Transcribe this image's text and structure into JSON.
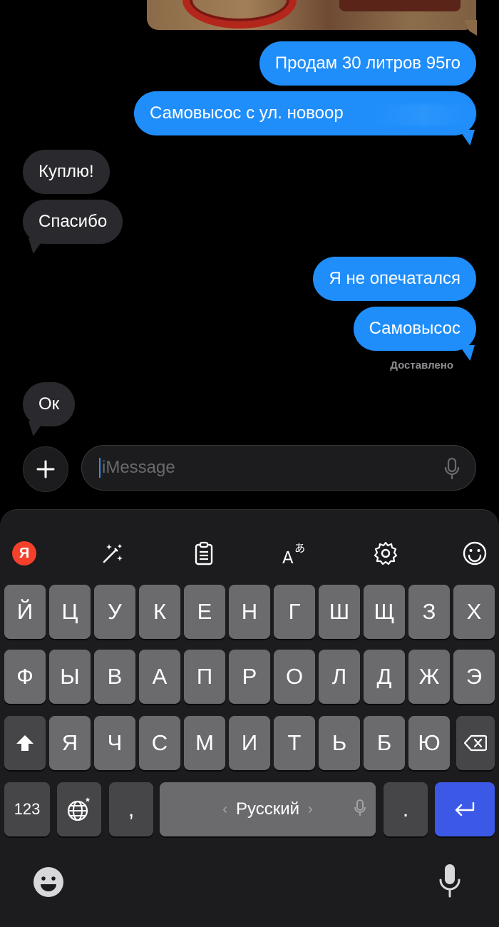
{
  "chat": {
    "messages": [
      {
        "direction": "out",
        "text": "Продам 30 литров 95го"
      },
      {
        "direction": "out",
        "text": "Самовысос с ул. новоор"
      },
      {
        "direction": "in",
        "text": "Куплю!"
      },
      {
        "direction": "in",
        "text": "Спасибо"
      },
      {
        "direction": "out",
        "text": "Я не опечатался"
      },
      {
        "direction": "out",
        "text": "Самовысос"
      },
      {
        "direction": "in",
        "text": "Ок"
      }
    ],
    "delivered_label": "Доставлено"
  },
  "input_bar": {
    "placeholder": "iMessage",
    "plus_icon": "plus-icon",
    "mic_icon": "microphone-icon"
  },
  "keyboard": {
    "toolbar_icons": [
      "yandex-logo-icon",
      "magic-wand-icon",
      "clipboard-icon",
      "translate-icon",
      "gear-icon",
      "smiley-icon"
    ],
    "yandex_logo_letter": "Я",
    "row1": [
      "Й",
      "Ц",
      "У",
      "К",
      "Е",
      "Н",
      "Г",
      "Ш",
      "Щ",
      "З",
      "Х"
    ],
    "row2": [
      "Ф",
      "Ы",
      "В",
      "А",
      "П",
      "Р",
      "О",
      "Л",
      "Д",
      "Ж",
      "Э"
    ],
    "row3": [
      "Я",
      "Ч",
      "С",
      "М",
      "И",
      "Т",
      "Ь",
      "Б",
      "Ю"
    ],
    "numbers_key": "123",
    "comma_key": ",",
    "space_label": "Русский",
    "period_key": ".",
    "accent_color": "#3c58e6"
  },
  "colors": {
    "outgoing_bubble": "#1f8efb",
    "incoming_bubble": "#2a2a2e",
    "background": "#000000"
  }
}
